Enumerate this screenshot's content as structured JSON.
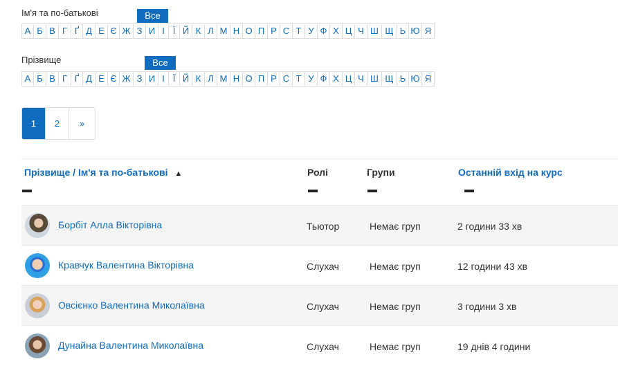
{
  "filters": {
    "first_name_label": "Ім'я та по-батькові",
    "last_name_label": "Прізвище",
    "all_label": "Все",
    "letters": [
      "А",
      "Б",
      "В",
      "Г",
      "Ґ",
      "Д",
      "Е",
      "Є",
      "Ж",
      "З",
      "И",
      "І",
      "Ї",
      "Й",
      "К",
      "Л",
      "М",
      "Н",
      "О",
      "П",
      "Р",
      "С",
      "Т",
      "У",
      "Ф",
      "Х",
      "Ц",
      "Ч",
      "Ш",
      "Щ",
      "Ь",
      "Ю",
      "Я"
    ]
  },
  "pagination": {
    "pages": [
      "1",
      "2"
    ],
    "next": "»",
    "active": "1"
  },
  "table": {
    "headers": {
      "name": "Прізвище / Ім'я та по-батькові",
      "sort_indicator": "▲",
      "roles": "Ролі",
      "groups": "Групи",
      "last_access": "Останній вхід на курс"
    },
    "rows": [
      {
        "name": "Борбіт Алла Вікторівна",
        "role": "Тьютор",
        "group": "Немає груп",
        "last_access": "2 години 33 хв"
      },
      {
        "name": "Кравчук Валентина Вікторівна",
        "role": "Слухач",
        "group": "Немає груп",
        "last_access": "12 години 43 хв"
      },
      {
        "name": "Овсієнко Валентина Миколаївна",
        "role": "Слухач",
        "group": "Немає груп",
        "last_access": "3 години 3 хв"
      },
      {
        "name": "Дунайна Валентина Миколаївна",
        "role": "Слухач",
        "group": "Немає груп",
        "last_access": "19 днів 4 години"
      }
    ]
  },
  "colors": {
    "accent": "#0f6cbf"
  }
}
